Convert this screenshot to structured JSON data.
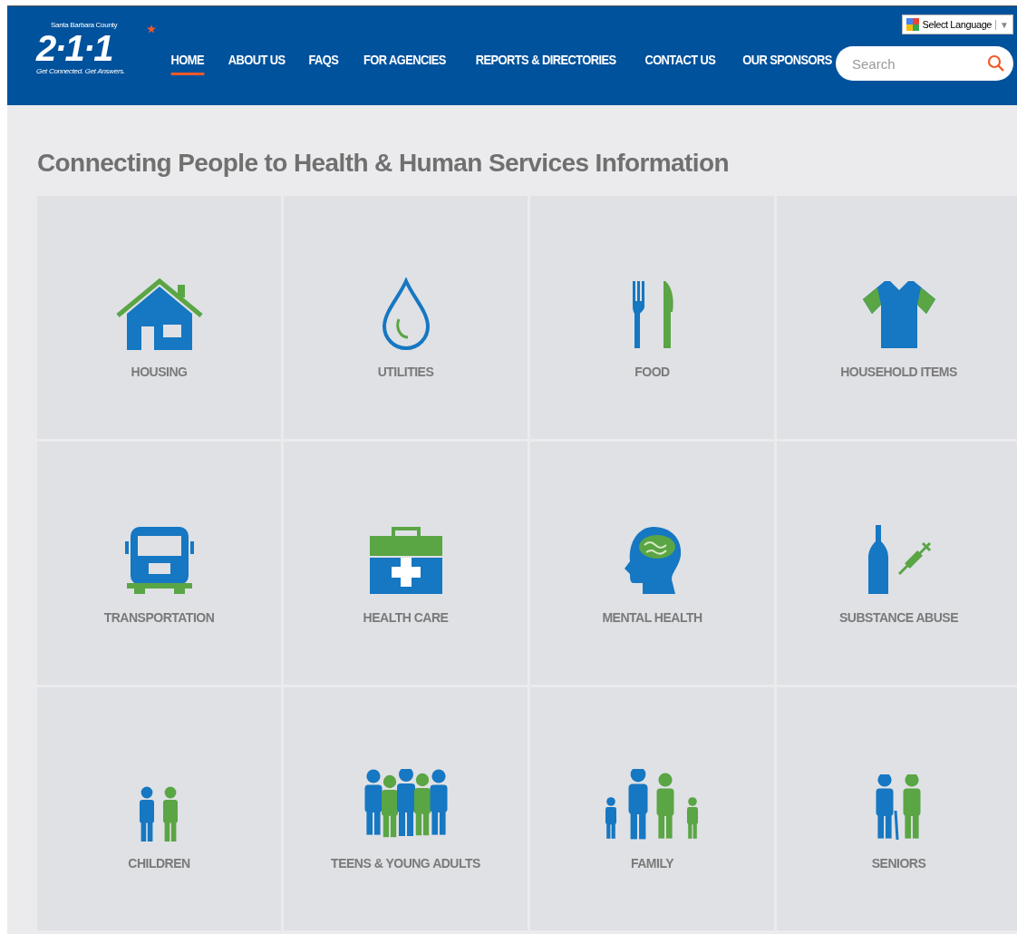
{
  "logo": {
    "county": "Santa Barbara County",
    "number": "2·1·1",
    "tagline": "Get Connected. Get Answers."
  },
  "language": {
    "label": "Select Language",
    "caret": "▼"
  },
  "nav": [
    {
      "label": "HOME",
      "selected": true
    },
    {
      "label": "ABOUT US",
      "selected": false
    },
    {
      "label": "FAQS",
      "selected": false
    },
    {
      "label": "FOR AGENCIES",
      "selected": false
    },
    {
      "label": "REPORTS & DIRECTORIES",
      "selected": false
    },
    {
      "label": "CONTACT US",
      "selected": false
    },
    {
      "label": "OUR SPONSORS",
      "selected": false
    }
  ],
  "search": {
    "placeholder": "Search"
  },
  "heading": "Connecting People to Health & Human Services Information",
  "categories": [
    {
      "label": "HOUSING",
      "kind": "house"
    },
    {
      "label": "UTILITIES",
      "kind": "drop"
    },
    {
      "label": "FOOD",
      "kind": "fork"
    },
    {
      "label": "HOUSEHOLD ITEMS",
      "kind": "shirt"
    },
    {
      "label": "TRANSPORTATION",
      "kind": "bus"
    },
    {
      "label": "HEALTH CARE",
      "kind": "kit"
    },
    {
      "label": "MENTAL HEALTH",
      "kind": "head"
    },
    {
      "label": "SUBSTANCE ABUSE",
      "kind": "bottle"
    },
    {
      "label": "CHILDREN",
      "kind": "children"
    },
    {
      "label": "TEENS & YOUNG ADULTS",
      "kind": "teens"
    },
    {
      "label": "FAMILY",
      "kind": "family"
    },
    {
      "label": "SENIORS",
      "kind": "seniors"
    }
  ]
}
